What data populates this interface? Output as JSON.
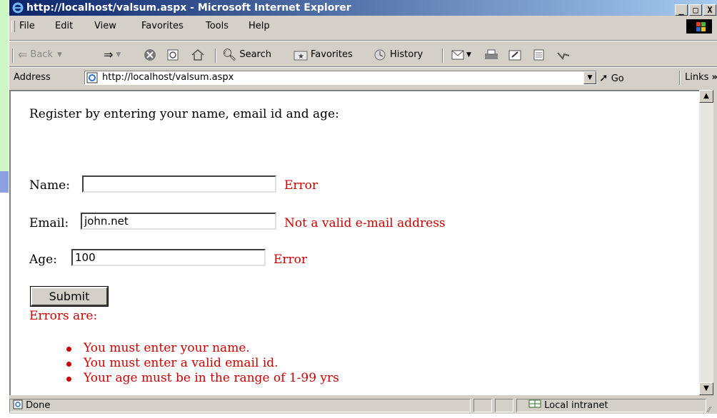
{
  "window": {
    "title": "http://localhost/valsum.aspx - Microsoft Internet Explorer",
    "controls": {
      "minimize": "_",
      "maximize": "□",
      "close": "X"
    }
  },
  "menu": {
    "items": [
      "File",
      "Edit",
      "View",
      "Favorites",
      "Tools",
      "Help"
    ]
  },
  "toolbar": {
    "back": "Back",
    "search": "Search",
    "favorites": "Favorites",
    "history": "History"
  },
  "address": {
    "label": "Address",
    "url": "http://localhost/valsum.aspx",
    "go": "Go",
    "links": "Links"
  },
  "page": {
    "intro": "Register by entering your name, email id and age:",
    "name_label": "Name:",
    "name_value": "",
    "name_error": "Error",
    "email_label": "Email:",
    "email_value": "john.net",
    "email_error": "Not a valid e-mail address",
    "age_label": "Age:",
    "age_value": "100",
    "age_error": "Error",
    "submit": "Submit",
    "errors_heading": "Errors are:",
    "errors": [
      "You must enter your name.",
      "You must enter a valid email id.",
      "Your age must be in the range of 1-99 yrs"
    ]
  },
  "status": {
    "text": "Done",
    "zone": "Local intranet"
  },
  "colors": {
    "error": "#cc0000",
    "titlebar_start": "#0a246a",
    "titlebar_end": "#a6caf0",
    "chrome": "#d4d0c8"
  }
}
